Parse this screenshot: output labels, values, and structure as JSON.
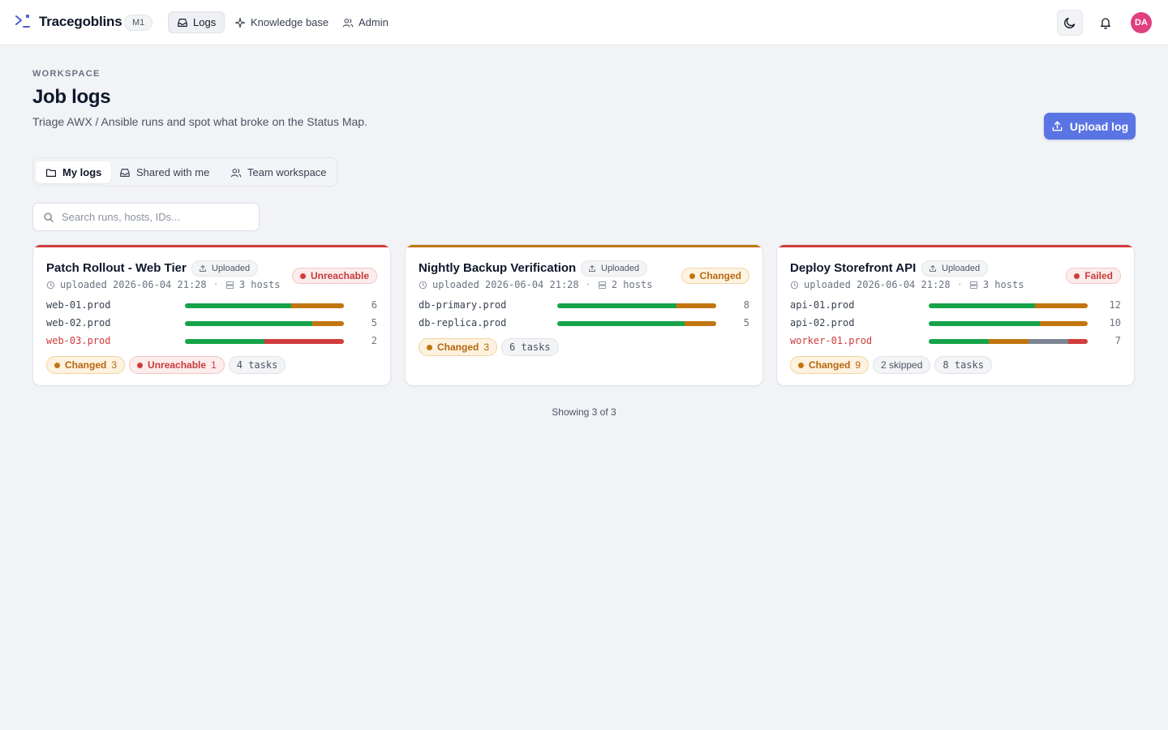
{
  "app": {
    "name": "Tracegoblins",
    "badge": "M1",
    "nav": [
      {
        "label": "Logs",
        "icon": "inbox-icon",
        "active": true
      },
      {
        "label": "Knowledge base",
        "icon": "sparkle-icon",
        "active": false
      },
      {
        "label": "Admin",
        "icon": "users-icon",
        "active": false
      }
    ],
    "avatar_initials": "DA"
  },
  "header": {
    "eyebrow": "WORKSPACE",
    "title": "Job logs",
    "subtitle": "Triage AWX / Ansible runs and spot what broke on the Status Map.",
    "upload_label": "Upload log"
  },
  "tabs": [
    {
      "label": "My logs",
      "icon": "folder-icon",
      "active": true
    },
    {
      "label": "Shared with me",
      "icon": "inbox-icon",
      "active": false
    },
    {
      "label": "Team workspace",
      "icon": "users-icon",
      "active": false
    }
  ],
  "search": {
    "placeholder": "Search runs, hosts, IDs...",
    "value": ""
  },
  "colors": {
    "ok": "#16a34a",
    "changed": "#c2750f",
    "failed": "#d23c3c",
    "skipped": "#7c8594",
    "brand": "#5b74e4"
  },
  "cards": [
    {
      "title": "Patch Rollout - Web Tier",
      "source": "Uploaded",
      "status": "Unreachable",
      "status_tone": "red",
      "accent": "#d23c3c",
      "uploaded": "uploaded 2026-06-04 21:28",
      "hosts_label": "3 hosts",
      "hosts": [
        {
          "name": "web-01.prod",
          "count": "6",
          "bad": false,
          "segments": [
            {
              "kind": "ok",
              "fraction": 0.67
            },
            {
              "kind": "changed",
              "fraction": 0.33
            }
          ]
        },
        {
          "name": "web-02.prod",
          "count": "5",
          "bad": false,
          "segments": [
            {
              "kind": "ok",
              "fraction": 0.8
            },
            {
              "kind": "changed",
              "fraction": 0.2
            }
          ]
        },
        {
          "name": "web-03.prod",
          "count": "2",
          "bad": true,
          "segments": [
            {
              "kind": "ok",
              "fraction": 0.5
            },
            {
              "kind": "failed",
              "fraction": 0.5
            }
          ]
        }
      ],
      "chips": [
        {
          "label": "Changed",
          "num": "3",
          "tone": "amber"
        },
        {
          "label": "Unreachable",
          "num": "1",
          "tone": "red"
        },
        {
          "label": "4 tasks",
          "num": "",
          "tone": "gray",
          "mono": true
        }
      ]
    },
    {
      "title": "Nightly Backup Verification",
      "source": "Uploaded",
      "status": "Changed",
      "status_tone": "amber",
      "accent": "#c2750f",
      "uploaded": "uploaded 2026-06-04 21:28",
      "hosts_label": "2 hosts",
      "hosts": [
        {
          "name": "db-primary.prod",
          "count": "8",
          "bad": false,
          "segments": [
            {
              "kind": "ok",
              "fraction": 0.75
            },
            {
              "kind": "changed",
              "fraction": 0.25
            }
          ]
        },
        {
          "name": "db-replica.prod",
          "count": "5",
          "bad": false,
          "segments": [
            {
              "kind": "ok",
              "fraction": 0.8
            },
            {
              "kind": "changed",
              "fraction": 0.2
            }
          ]
        }
      ],
      "chips": [
        {
          "label": "Changed",
          "num": "3",
          "tone": "amber"
        },
        {
          "label": "6 tasks",
          "num": "",
          "tone": "gray",
          "mono": true
        }
      ]
    },
    {
      "title": "Deploy Storefront API",
      "source": "Uploaded",
      "status": "Failed",
      "status_tone": "red",
      "accent": "#d23c3c",
      "uploaded": "uploaded 2026-06-04 21:28",
      "hosts_label": "3 hosts",
      "hosts": [
        {
          "name": "api-01.prod",
          "count": "12",
          "bad": false,
          "segments": [
            {
              "kind": "ok",
              "fraction": 0.67
            },
            {
              "kind": "changed",
              "fraction": 0.33
            }
          ]
        },
        {
          "name": "api-02.prod",
          "count": "10",
          "bad": false,
          "segments": [
            {
              "kind": "ok",
              "fraction": 0.7
            },
            {
              "kind": "changed",
              "fraction": 0.3
            }
          ]
        },
        {
          "name": "worker-01.prod",
          "count": "7",
          "bad": true,
          "segments": [
            {
              "kind": "ok",
              "fraction": 0.375
            },
            {
              "kind": "changed",
              "fraction": 0.25
            },
            {
              "kind": "skipped",
              "fraction": 0.25
            },
            {
              "kind": "failed",
              "fraction": 0.125
            }
          ]
        }
      ],
      "chips": [
        {
          "label": "Changed",
          "num": "9",
          "tone": "amber"
        },
        {
          "label": "2 skipped",
          "num": "",
          "tone": "gray"
        },
        {
          "label": "8 tasks",
          "num": "",
          "tone": "gray",
          "mono": true
        }
      ]
    }
  ],
  "footer": {
    "showing": "Showing 3 of 3"
  }
}
